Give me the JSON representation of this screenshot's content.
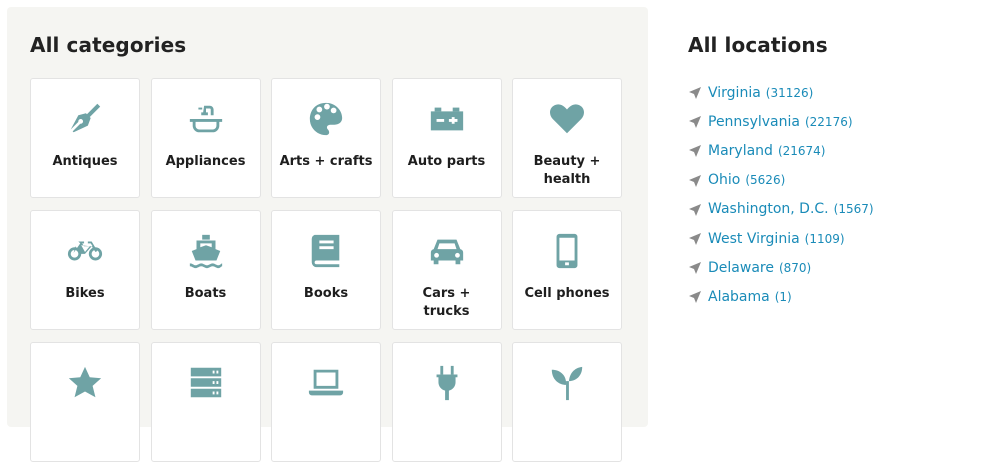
{
  "categories": {
    "title": "All categories",
    "tiles": [
      {
        "label": "Antiques",
        "icon": "fountain-pen-icon"
      },
      {
        "label": "Appliances",
        "icon": "sink-icon"
      },
      {
        "label": "Arts + crafts",
        "icon": "palette-icon"
      },
      {
        "label": "Auto parts",
        "icon": "car-battery-icon"
      },
      {
        "label": "Beauty + health",
        "icon": "heart-icon"
      },
      {
        "label": "Bikes",
        "icon": "bicycle-icon"
      },
      {
        "label": "Boats",
        "icon": "ship-icon"
      },
      {
        "label": "Books",
        "icon": "book-icon"
      },
      {
        "label": "Cars + trucks",
        "icon": "car-icon"
      },
      {
        "label": "Cell phones",
        "icon": "mobile-phone-icon"
      },
      {
        "label": "",
        "icon": "star-icon"
      },
      {
        "label": "",
        "icon": "server-icon"
      },
      {
        "label": "",
        "icon": "laptop-icon"
      },
      {
        "label": "",
        "icon": "plug-icon"
      },
      {
        "label": "",
        "icon": "seedling-icon"
      }
    ]
  },
  "locations": {
    "title": "All locations",
    "icon": "location-arrow-icon",
    "link_color": "#1a8bb8",
    "items": [
      {
        "name": "Virginia",
        "count": "(31126)"
      },
      {
        "name": "Pennsylvania",
        "count": "(22176)"
      },
      {
        "name": "Maryland",
        "count": "(21674)"
      },
      {
        "name": "Ohio",
        "count": "(5626)"
      },
      {
        "name": "Washington, D.C.",
        "count": "(1567)"
      },
      {
        "name": "West Virginia",
        "count": "(1109)"
      },
      {
        "name": "Delaware",
        "count": "(870)"
      },
      {
        "name": "Alabama",
        "count": "(1)"
      }
    ]
  },
  "theme": {
    "icon_color": "#6fa3a5",
    "panel_bg": "#f5f5f2"
  }
}
